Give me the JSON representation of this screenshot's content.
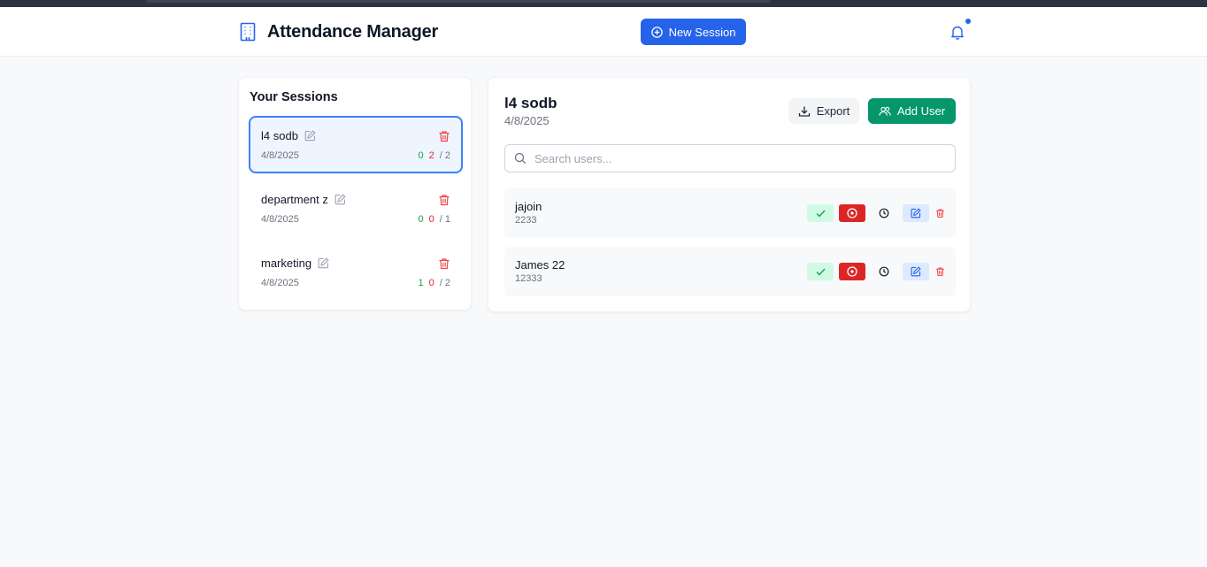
{
  "header": {
    "app_title": "Attendance Manager",
    "logo_icon": "building-icon",
    "new_session_label": "New Session",
    "notification_icon": "bell-icon",
    "accent_color": "#2563eb"
  },
  "sidebar": {
    "title": "Your Sessions",
    "sessions": [
      {
        "name": "l4 sodb",
        "date": "4/8/2025",
        "present": "0",
        "absent": "2",
        "total": "/ 2",
        "active": true
      },
      {
        "name": "department z",
        "date": "4/8/2025",
        "present": "0",
        "absent": "0",
        "total": "/ 1",
        "active": false
      },
      {
        "name": "marketing",
        "date": "4/8/2025",
        "present": "1",
        "absent": "0",
        "total": "/ 2",
        "active": false
      }
    ]
  },
  "detail": {
    "title": "l4 sodb",
    "date": "4/8/2025",
    "export_label": "Export",
    "add_user_label": "Add User",
    "search_placeholder": "Search users...",
    "users": [
      {
        "name": "jajoin",
        "id": "2233"
      },
      {
        "name": "James 22",
        "id": "12333"
      }
    ],
    "status_colors": {
      "present": "#16a34a",
      "absent": "#dc2626",
      "add_user": "#059669"
    }
  }
}
